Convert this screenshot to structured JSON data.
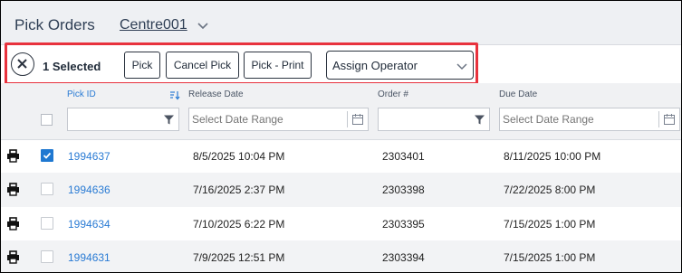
{
  "header": {
    "title": "Pick Orders",
    "centre": "Centre001"
  },
  "toolbar": {
    "selected_text": "1 Selected",
    "buttons": [
      "Pick",
      "Cancel Pick",
      "Pick - Print"
    ],
    "assign_operator": "Assign Operator"
  },
  "grid": {
    "columns": {
      "pick_id": "Pick ID",
      "release_date": "Release Date",
      "order_no": "Order #",
      "due_date": "Due Date"
    },
    "filters": {
      "release_placeholder": "Select Date Range",
      "due_placeholder": "Select Date Range"
    },
    "rows": [
      {
        "pick_id": "1994637",
        "release_date": "8/5/2025 10:04 PM",
        "order_no": "2303401",
        "due_date": "8/11/2025 10:00 PM",
        "selected": true
      },
      {
        "pick_id": "1994636",
        "release_date": "7/16/2025 2:37 PM",
        "order_no": "2303398",
        "due_date": "7/22/2025 8:00 PM",
        "selected": false
      },
      {
        "pick_id": "1994634",
        "release_date": "7/10/2025 6:22 PM",
        "order_no": "2303395",
        "due_date": "7/15/2025 1:00 PM",
        "selected": false
      },
      {
        "pick_id": "1994631",
        "release_date": "7/9/2025 12:51 PM",
        "order_no": "2303394",
        "due_date": "7/15/2025 1:00 PM",
        "selected": false
      }
    ]
  },
  "colors": {
    "accent": "#2a7bd4",
    "highlight": "#e8323d",
    "checked": "#1f78d1"
  },
  "icons": {
    "clear": "close-circle-icon",
    "centre_dropdown": "chevron-down-icon",
    "sort": "sort-descending-icon",
    "filter": "funnel-icon",
    "calendar": "calendar-icon",
    "print": "printer-icon"
  }
}
